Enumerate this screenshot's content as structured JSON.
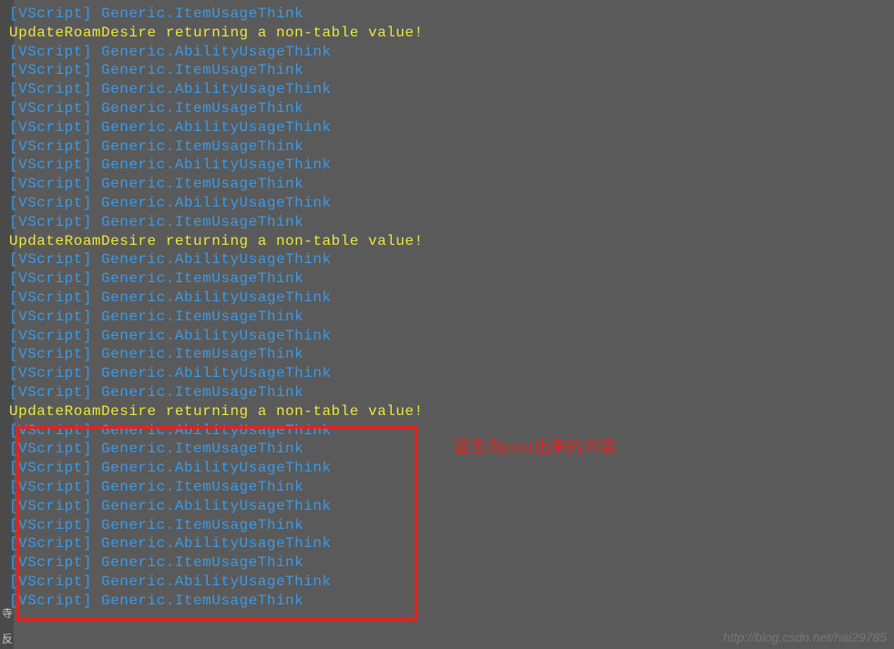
{
  "lines": [
    {
      "type": "vscript",
      "text": "[VScript] Generic.ItemUsageThink"
    },
    {
      "type": "warning",
      "text": "UpdateRoamDesire returning a non-table value!"
    },
    {
      "type": "vscript",
      "text": "[VScript] Generic.AbilityUsageThink"
    },
    {
      "type": "vscript",
      "text": "[VScript] Generic.ItemUsageThink"
    },
    {
      "type": "vscript",
      "text": "[VScript] Generic.AbilityUsageThink"
    },
    {
      "type": "vscript",
      "text": "[VScript] Generic.ItemUsageThink"
    },
    {
      "type": "vscript",
      "text": "[VScript] Generic.AbilityUsageThink"
    },
    {
      "type": "vscript",
      "text": "[VScript] Generic.ItemUsageThink"
    },
    {
      "type": "vscript",
      "text": "[VScript] Generic.AbilityUsageThink"
    },
    {
      "type": "vscript",
      "text": "[VScript] Generic.ItemUsageThink"
    },
    {
      "type": "vscript",
      "text": "[VScript] Generic.AbilityUsageThink"
    },
    {
      "type": "vscript",
      "text": "[VScript] Generic.ItemUsageThink"
    },
    {
      "type": "warning",
      "text": "UpdateRoamDesire returning a non-table value!"
    },
    {
      "type": "vscript",
      "text": "[VScript] Generic.AbilityUsageThink"
    },
    {
      "type": "vscript",
      "text": "[VScript] Generic.ItemUsageThink"
    },
    {
      "type": "vscript",
      "text": "[VScript] Generic.AbilityUsageThink"
    },
    {
      "type": "vscript",
      "text": "[VScript] Generic.ItemUsageThink"
    },
    {
      "type": "vscript",
      "text": "[VScript] Generic.AbilityUsageThink"
    },
    {
      "type": "vscript",
      "text": "[VScript] Generic.ItemUsageThink"
    },
    {
      "type": "vscript",
      "text": "[VScript] Generic.AbilityUsageThink"
    },
    {
      "type": "vscript",
      "text": "[VScript] Generic.ItemUsageThink"
    },
    {
      "type": "warning",
      "text": "UpdateRoamDesire returning a non-table value!"
    },
    {
      "type": "vscript",
      "text": "[VScript] Generic.AbilityUsageThink"
    },
    {
      "type": "vscript",
      "text": "[VScript] Generic.ItemUsageThink"
    },
    {
      "type": "vscript",
      "text": "[VScript] Generic.AbilityUsageThink"
    },
    {
      "type": "vscript",
      "text": "[VScript] Generic.ItemUsageThink"
    },
    {
      "type": "vscript",
      "text": "[VScript] Generic.AbilityUsageThink"
    },
    {
      "type": "vscript",
      "text": "[VScript] Generic.ItemUsageThink"
    },
    {
      "type": "vscript",
      "text": "[VScript] Generic.AbilityUsageThink"
    },
    {
      "type": "vscript",
      "text": "[VScript] Generic.ItemUsageThink"
    },
    {
      "type": "vscript",
      "text": "[VScript] Generic.AbilityUsageThink"
    },
    {
      "type": "vscript",
      "text": "[VScript] Generic.ItemUsageThink"
    }
  ],
  "annotation": "蓝色为print出来的内容",
  "watermark": "http://blog.csdn.net/hai29785",
  "sideChar1": "寺",
  "sideChar2": "反"
}
